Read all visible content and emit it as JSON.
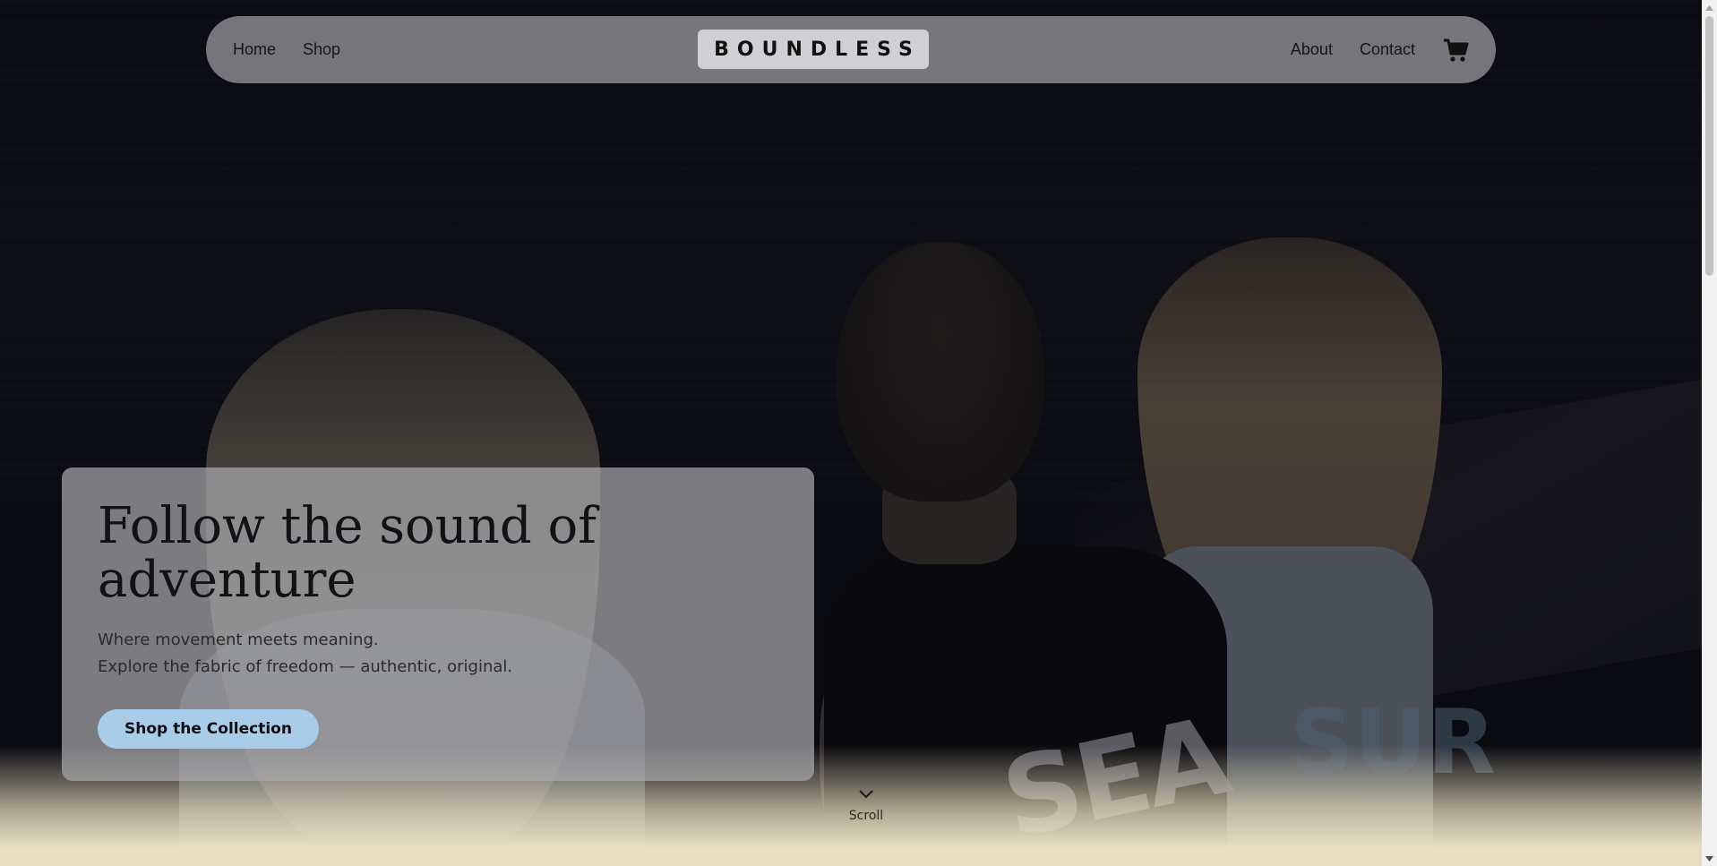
{
  "navbar": {
    "links_left": [
      "Home",
      "Shop"
    ],
    "logo_text": "BOUNDLESS",
    "links_right": [
      "About",
      "Contact"
    ],
    "cart_icon": "shopping-cart-icon"
  },
  "hero": {
    "title": "Follow the sound of adventure",
    "subtitle_line1": "Where movement meets meaning.",
    "subtitle_line2": "Explore the fabric of freedom — authentic, original.",
    "cta_label": "Shop the Collection",
    "shirt_print_left": "SEA",
    "shirt_print_right": "SUR"
  },
  "scroll": {
    "label": "Scroll",
    "icon": "chevron-down-icon"
  },
  "colors": {
    "accent_button": "#a9cde9",
    "background_fade": "#e7dfbf",
    "navbar": "#8c8c91"
  }
}
